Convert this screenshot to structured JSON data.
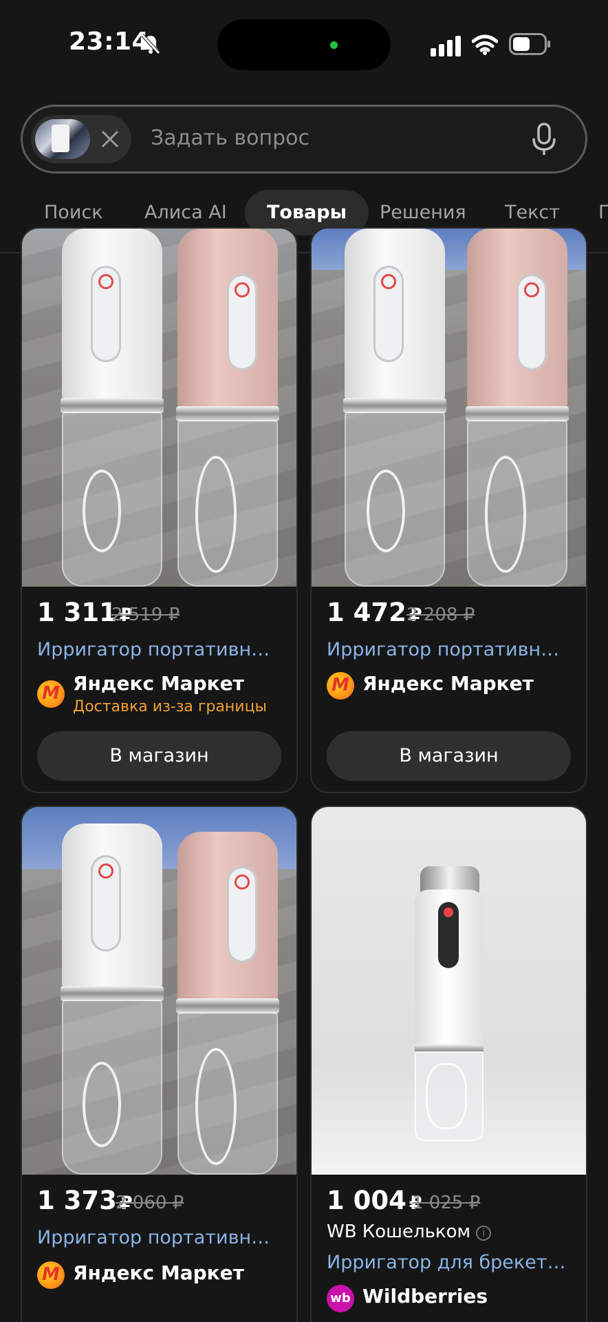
{
  "status_bar": {
    "time": "23:14"
  },
  "search": {
    "placeholder": "Задать вопрос"
  },
  "tabs": [
    {
      "label": "Поиск"
    },
    {
      "label": "Алиса AI"
    },
    {
      "label": "Товары",
      "active": true
    },
    {
      "label": "Решения"
    },
    {
      "label": "Текст"
    },
    {
      "label": "П"
    }
  ],
  "products": [
    {
      "price": "1 311",
      "currency": "₽",
      "old_price": "2 519 ₽",
      "title": "Ирригатор портативный для зубов",
      "seller": "Яндекс Маркет",
      "delivery": "Доставка из-за границы",
      "button": "В магазин"
    },
    {
      "price": "1 472",
      "currency": "₽",
      "old_price": "2 208 ₽",
      "title": "Ирригатор портативный для зубов",
      "seller": "Яндекс Маркет",
      "button": "В магазин"
    },
    {
      "price": "1 373",
      "currency": "₽",
      "old_price": "2 060 ₽",
      "title": "Ирригатор портативный для зубов",
      "seller": "Яндекс Маркет"
    },
    {
      "price": "1 004",
      "currency": "₽",
      "old_price": "1 025 ₽",
      "wallet": "WB Кошельком",
      "title": "Ирригатор для брекетов и зубов",
      "seller": "Wildberries",
      "seller_logo": "wb"
    }
  ],
  "colors": {
    "background": "#161616",
    "link": "#8ab4e8",
    "delivery": "#f0a030",
    "wb_brand": "#cb11ab"
  }
}
